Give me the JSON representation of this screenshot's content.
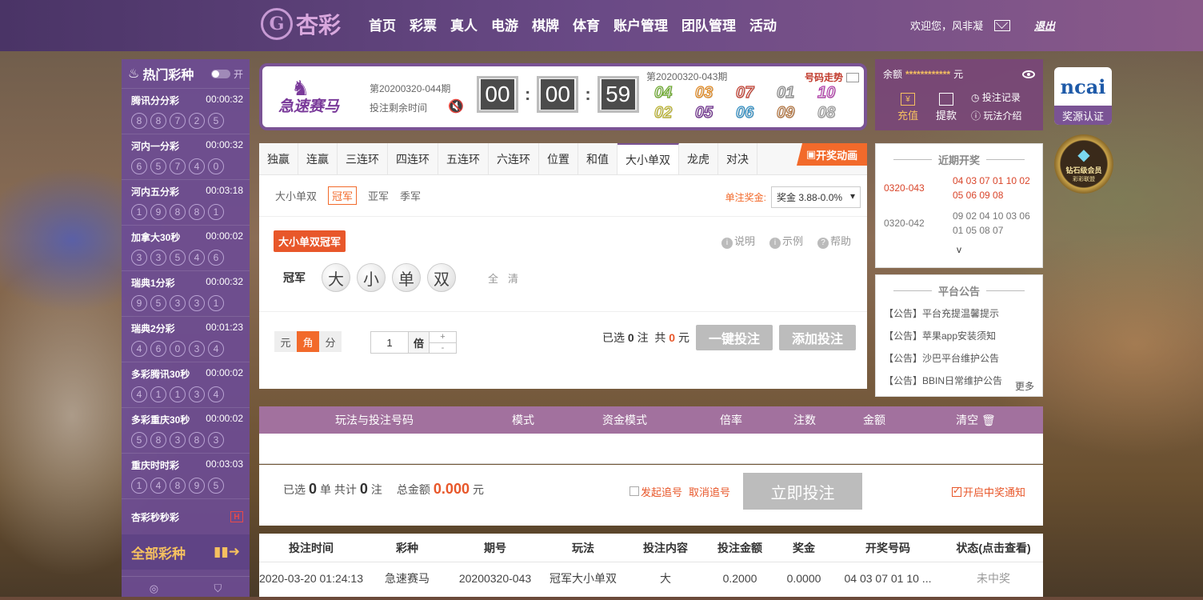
{
  "brand": {
    "logo_glyph": "G",
    "name": "杏彩"
  },
  "nav": [
    "首页",
    "彩票",
    "真人",
    "电游",
    "棋牌",
    "体育",
    "账户管理",
    "团队管理",
    "活动"
  ],
  "user": {
    "welcome": "欢迎您，风非凝",
    "logout": "退出"
  },
  "sidebar": {
    "title": "热门彩种",
    "toggle_label": "开",
    "lotteries": [
      {
        "name": "腾讯分分彩",
        "time": "00:00:32",
        "balls": [
          "8",
          "8",
          "7",
          "2",
          "5"
        ]
      },
      {
        "name": "河内一分彩",
        "time": "00:00:32",
        "balls": [
          "6",
          "5",
          "7",
          "4",
          "0"
        ]
      },
      {
        "name": "河内五分彩",
        "time": "00:03:18",
        "balls": [
          "1",
          "9",
          "8",
          "8",
          "1"
        ]
      },
      {
        "name": "加拿大30秒",
        "time": "00:00:02",
        "balls": [
          "3",
          "3",
          "5",
          "4",
          "6"
        ]
      },
      {
        "name": "瑞典1分彩",
        "time": "00:00:32",
        "balls": [
          "9",
          "5",
          "3",
          "3",
          "1"
        ]
      },
      {
        "name": "瑞典2分彩",
        "time": "00:01:23",
        "balls": [
          "4",
          "6",
          "0",
          "3",
          "4"
        ]
      },
      {
        "name": "多彩腾讯30秒",
        "time": "00:00:02",
        "balls": [
          "4",
          "1",
          "1",
          "3",
          "4"
        ]
      },
      {
        "name": "多彩重庆30秒",
        "time": "00:00:02",
        "balls": [
          "5",
          "8",
          "3",
          "8",
          "3"
        ]
      },
      {
        "name": "重庆时时彩",
        "time": "00:03:03",
        "balls": [
          "1",
          "4",
          "8",
          "9",
          "5"
        ]
      }
    ],
    "extra_item": "杏彩秒秒彩",
    "extra_badge": "H",
    "all_label": "全部彩种"
  },
  "game": {
    "name": "急速赛马",
    "period": "第20200320-044期",
    "remain_label": "投注剩余时间",
    "countdown": [
      "00",
      "00",
      "59"
    ],
    "last_period": "第20200320-043期",
    "trend_label": "号码走势",
    "draw_numbers": [
      {
        "n": "04",
        "c": "#6aa82a"
      },
      {
        "n": "03",
        "c": "#e0851a"
      },
      {
        "n": "07",
        "c": "#c0392b"
      },
      {
        "n": "01",
        "c": "#888888"
      },
      {
        "n": "10",
        "c": "#b03aa8"
      },
      {
        "n": "02",
        "c": "#b8b02a"
      },
      {
        "n": "05",
        "c": "#6a2a8a"
      },
      {
        "n": "06",
        "c": "#2a8ac0"
      },
      {
        "n": "09",
        "c": "#b0703a"
      },
      {
        "n": "08",
        "c": "#999999"
      }
    ]
  },
  "account": {
    "balance_label": "余额",
    "balance_masked": "************",
    "currency": "元",
    "deposit": "充值",
    "withdraw": "提款",
    "records": "投注记录",
    "rules": "玩法介绍"
  },
  "badges": {
    "ncai_title": "ncai",
    "ncai_label": "奖源认证",
    "diamond_label": "钻石级会员",
    "diamond_sub": "彩彩联盟"
  },
  "tabs": [
    "独赢",
    "连赢",
    "三连环",
    "四连环",
    "五连环",
    "六连环",
    "位置",
    "和值",
    "大小单双",
    "龙虎",
    "对决"
  ],
  "active_tab": 8,
  "anim_label": "开奖动画",
  "subtabs": {
    "group": "大小单双",
    "items": [
      "冠军",
      "亚军",
      "季军"
    ],
    "active": 0
  },
  "single_prize": {
    "label": "单注奖金:",
    "value": "奖金 3.88-0.0%"
  },
  "play_tag": "大小单双冠军",
  "help": [
    "说明",
    "示例",
    "帮助"
  ],
  "pick": {
    "label": "冠军",
    "balls": [
      "大",
      "小",
      "单",
      "双"
    ],
    "all": "全",
    "clear": "清"
  },
  "units": [
    "元",
    "角",
    "分"
  ],
  "units_active": 1,
  "multiplier": {
    "value": "1",
    "unit": "倍",
    "plus": "+",
    "minus": "-"
  },
  "summary": {
    "selected_label": "已选",
    "selected": "0",
    "bet_unit": "注",
    "total_label": "共",
    "total": "0",
    "yuan": "元",
    "quick_bet": "一键投注",
    "add_bet": "添加投注"
  },
  "recent": {
    "title": "近期开奖",
    "rows": [
      {
        "period": "0320-043",
        "nums": "04 03 07 01 10 02 05 06 09 08"
      },
      {
        "period": "0320-042",
        "nums": "09 02 04 10 03 06 01 05 08 07"
      }
    ],
    "expand": "v"
  },
  "notice": {
    "title": "平台公告",
    "items": [
      "【公告】平台充提温馨提示",
      "【公告】苹果app安装须知",
      "【公告】沙巴平台维护公告",
      "【公告】BBIN日常维护公告"
    ],
    "more": "更多"
  },
  "order_head": [
    "玩法与投注号码",
    "模式",
    "资金模式",
    "倍率",
    "注数",
    "金额",
    "清空"
  ],
  "confirm": {
    "selected_label": "已选",
    "orders": "0",
    "order_unit": "单 共计",
    "bets": "0",
    "bet_unit": "注",
    "amount_label": "总金额",
    "amount": "0.000",
    "yuan": "元",
    "chase": "发起追号",
    "cancel_chase": "取消追号",
    "bet_now": "立即投注",
    "notify": "开启中奖通知"
  },
  "history": {
    "headers": [
      "投注时间",
      "彩种",
      "期号",
      "玩法",
      "投注内容",
      "投注金额",
      "奖金",
      "开奖号码",
      "状态(点击查看)"
    ],
    "rows": [
      [
        "2020-03-20 01:24:13",
        "急速赛马",
        "20200320-043",
        "冠军大小单双",
        "大",
        "0.2000",
        "0.0000",
        "04 03 07 01 10 ...",
        "未中奖"
      ]
    ]
  }
}
